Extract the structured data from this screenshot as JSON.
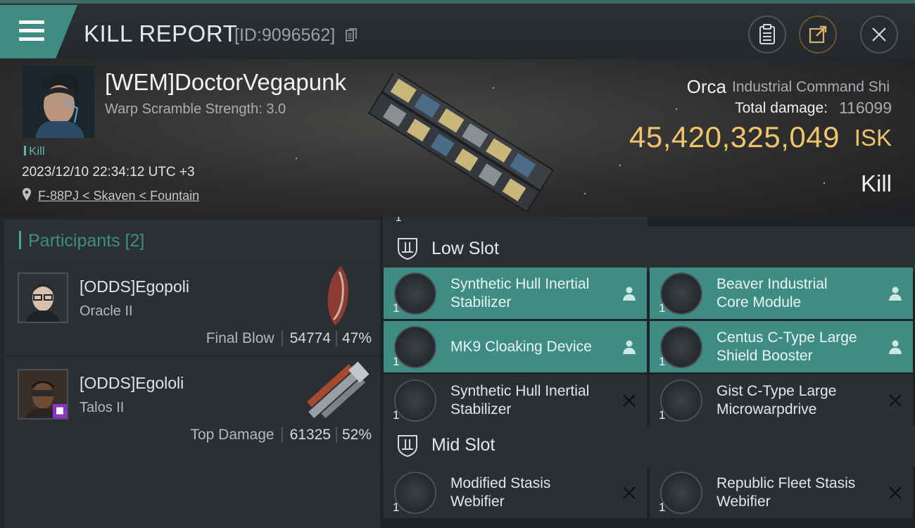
{
  "header": {
    "title": "KILL REPORT",
    "report_id": "[ID:9096562]",
    "icons": [
      "menu-icon",
      "copy-icon",
      "clipboard-icon",
      "share-icon",
      "close-icon"
    ]
  },
  "victim": {
    "pilot_name": "[WEM]DoctorVegapunk",
    "warp_scramble": "Warp Scramble Strength: 3.0",
    "kill_tag": "Kill",
    "datetime": "2023/12/10 22:34:12 UTC +3",
    "location": "F-88PJ < Skaven < Fountain",
    "ship_name": "Orca",
    "ship_class": "Industrial Command Shi",
    "total_damage_label": "Total damage:",
    "total_damage": "116099",
    "isk_value": "45,420,325,049",
    "isk_unit": "ISK",
    "result": "Kill"
  },
  "participants": {
    "title": "Participants [2]",
    "items": [
      {
        "name": "[ODDS]Egopoli",
        "ship": "Oracle II",
        "role": "Final Blow",
        "damage": "54774",
        "percent": "47%"
      },
      {
        "name": "[ODDS]Egololi",
        "ship": "Talos II",
        "role": "Top Damage",
        "damage": "61325",
        "percent": "52%"
      }
    ]
  },
  "slots": {
    "top_qty": "1",
    "low": {
      "label": "Low Slot",
      "modules": [
        {
          "name_line1": "Synthetic Hull Inertial",
          "name_line2": "Stabilizer",
          "qty": "1",
          "status": "pilot-icon"
        },
        {
          "name_line1": "Beaver Industrial",
          "name_line2": "Core Module",
          "qty": "1",
          "status": "pilot-icon"
        },
        {
          "name_line1": "MK9 Cloaking Device",
          "name_line2": "",
          "qty": "1",
          "status": "pilot-icon"
        },
        {
          "name_line1": "Centus C-Type Large",
          "name_line2": "Shield Booster",
          "qty": "1",
          "status": "pilot-icon"
        },
        {
          "name_line1": "Synthetic Hull Inertial",
          "name_line2": "Stabilizer",
          "qty": "1",
          "status": "destroyed-x-icon"
        },
        {
          "name_line1": "Gist C-Type Large",
          "name_line2": "Microwarpdrive",
          "qty": "1",
          "status": "destroyed-x-icon"
        }
      ]
    },
    "mid": {
      "label": "Mid Slot",
      "modules": [
        {
          "name_line1": "Modified Stasis",
          "name_line2": "Webifier",
          "qty": "1",
          "status": "destroyed-x-icon"
        },
        {
          "name_line1": "Republic Fleet Stasis",
          "name_line2": "Webifier",
          "qty": "1",
          "status": "destroyed-x-icon"
        }
      ]
    }
  },
  "colors": {
    "accent_teal": "#3f8c85",
    "isk_gold": "#f0c46a",
    "panel": "#2a2f33"
  }
}
